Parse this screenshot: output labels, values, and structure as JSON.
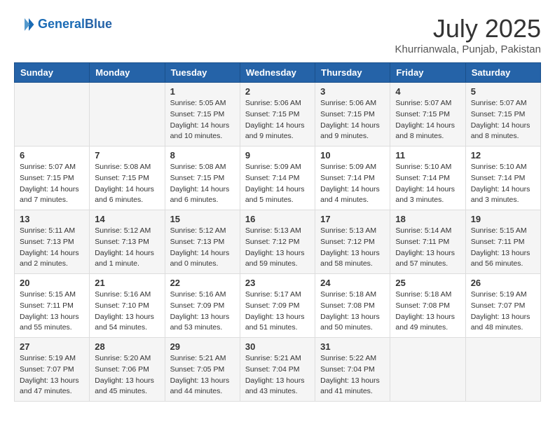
{
  "header": {
    "logo_line1": "General",
    "logo_line2": "Blue",
    "month_title": "July 2025",
    "location": "Khurrianwala, Punjab, Pakistan"
  },
  "days_of_week": [
    "Sunday",
    "Monday",
    "Tuesday",
    "Wednesday",
    "Thursday",
    "Friday",
    "Saturday"
  ],
  "weeks": [
    [
      {
        "day": "",
        "info": ""
      },
      {
        "day": "",
        "info": ""
      },
      {
        "day": "1",
        "info": "Sunrise: 5:05 AM\nSunset: 7:15 PM\nDaylight: 14 hours\nand 10 minutes."
      },
      {
        "day": "2",
        "info": "Sunrise: 5:06 AM\nSunset: 7:15 PM\nDaylight: 14 hours\nand 9 minutes."
      },
      {
        "day": "3",
        "info": "Sunrise: 5:06 AM\nSunset: 7:15 PM\nDaylight: 14 hours\nand 9 minutes."
      },
      {
        "day": "4",
        "info": "Sunrise: 5:07 AM\nSunset: 7:15 PM\nDaylight: 14 hours\nand 8 minutes."
      },
      {
        "day": "5",
        "info": "Sunrise: 5:07 AM\nSunset: 7:15 PM\nDaylight: 14 hours\nand 8 minutes."
      }
    ],
    [
      {
        "day": "6",
        "info": "Sunrise: 5:07 AM\nSunset: 7:15 PM\nDaylight: 14 hours\nand 7 minutes."
      },
      {
        "day": "7",
        "info": "Sunrise: 5:08 AM\nSunset: 7:15 PM\nDaylight: 14 hours\nand 6 minutes."
      },
      {
        "day": "8",
        "info": "Sunrise: 5:08 AM\nSunset: 7:15 PM\nDaylight: 14 hours\nand 6 minutes."
      },
      {
        "day": "9",
        "info": "Sunrise: 5:09 AM\nSunset: 7:14 PM\nDaylight: 14 hours\nand 5 minutes."
      },
      {
        "day": "10",
        "info": "Sunrise: 5:09 AM\nSunset: 7:14 PM\nDaylight: 14 hours\nand 4 minutes."
      },
      {
        "day": "11",
        "info": "Sunrise: 5:10 AM\nSunset: 7:14 PM\nDaylight: 14 hours\nand 3 minutes."
      },
      {
        "day": "12",
        "info": "Sunrise: 5:10 AM\nSunset: 7:14 PM\nDaylight: 14 hours\nand 3 minutes."
      }
    ],
    [
      {
        "day": "13",
        "info": "Sunrise: 5:11 AM\nSunset: 7:13 PM\nDaylight: 14 hours\nand 2 minutes."
      },
      {
        "day": "14",
        "info": "Sunrise: 5:12 AM\nSunset: 7:13 PM\nDaylight: 14 hours\nand 1 minute."
      },
      {
        "day": "15",
        "info": "Sunrise: 5:12 AM\nSunset: 7:13 PM\nDaylight: 14 hours\nand 0 minutes."
      },
      {
        "day": "16",
        "info": "Sunrise: 5:13 AM\nSunset: 7:12 PM\nDaylight: 13 hours\nand 59 minutes."
      },
      {
        "day": "17",
        "info": "Sunrise: 5:13 AM\nSunset: 7:12 PM\nDaylight: 13 hours\nand 58 minutes."
      },
      {
        "day": "18",
        "info": "Sunrise: 5:14 AM\nSunset: 7:11 PM\nDaylight: 13 hours\nand 57 minutes."
      },
      {
        "day": "19",
        "info": "Sunrise: 5:15 AM\nSunset: 7:11 PM\nDaylight: 13 hours\nand 56 minutes."
      }
    ],
    [
      {
        "day": "20",
        "info": "Sunrise: 5:15 AM\nSunset: 7:11 PM\nDaylight: 13 hours\nand 55 minutes."
      },
      {
        "day": "21",
        "info": "Sunrise: 5:16 AM\nSunset: 7:10 PM\nDaylight: 13 hours\nand 54 minutes."
      },
      {
        "day": "22",
        "info": "Sunrise: 5:16 AM\nSunset: 7:09 PM\nDaylight: 13 hours\nand 53 minutes."
      },
      {
        "day": "23",
        "info": "Sunrise: 5:17 AM\nSunset: 7:09 PM\nDaylight: 13 hours\nand 51 minutes."
      },
      {
        "day": "24",
        "info": "Sunrise: 5:18 AM\nSunset: 7:08 PM\nDaylight: 13 hours\nand 50 minutes."
      },
      {
        "day": "25",
        "info": "Sunrise: 5:18 AM\nSunset: 7:08 PM\nDaylight: 13 hours\nand 49 minutes."
      },
      {
        "day": "26",
        "info": "Sunrise: 5:19 AM\nSunset: 7:07 PM\nDaylight: 13 hours\nand 48 minutes."
      }
    ],
    [
      {
        "day": "27",
        "info": "Sunrise: 5:19 AM\nSunset: 7:07 PM\nDaylight: 13 hours\nand 47 minutes."
      },
      {
        "day": "28",
        "info": "Sunrise: 5:20 AM\nSunset: 7:06 PM\nDaylight: 13 hours\nand 45 minutes."
      },
      {
        "day": "29",
        "info": "Sunrise: 5:21 AM\nSunset: 7:05 PM\nDaylight: 13 hours\nand 44 minutes."
      },
      {
        "day": "30",
        "info": "Sunrise: 5:21 AM\nSunset: 7:04 PM\nDaylight: 13 hours\nand 43 minutes."
      },
      {
        "day": "31",
        "info": "Sunrise: 5:22 AM\nSunset: 7:04 PM\nDaylight: 13 hours\nand 41 minutes."
      },
      {
        "day": "",
        "info": ""
      },
      {
        "day": "",
        "info": ""
      }
    ]
  ]
}
